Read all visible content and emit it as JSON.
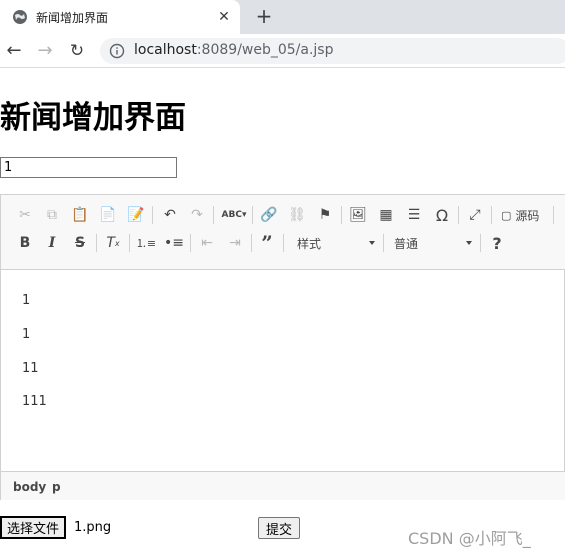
{
  "browser": {
    "tab_title": "新闻增加界面",
    "url_host": "localhost",
    "url_rest": ":8089/web_05/a.jsp"
  },
  "page": {
    "heading": "新闻增加界面",
    "title_input_value": "1"
  },
  "editor": {
    "source_label": "源码",
    "style_combo": "样式",
    "format_combo": "普通",
    "paragraphs": [
      "1",
      "1",
      "11",
      "111"
    ],
    "path": [
      "body",
      "p"
    ]
  },
  "form": {
    "file_button_label": "选择文件",
    "file_name": "1.png",
    "submit_label": "提交"
  },
  "watermark": "CSDN @小阿飞_"
}
